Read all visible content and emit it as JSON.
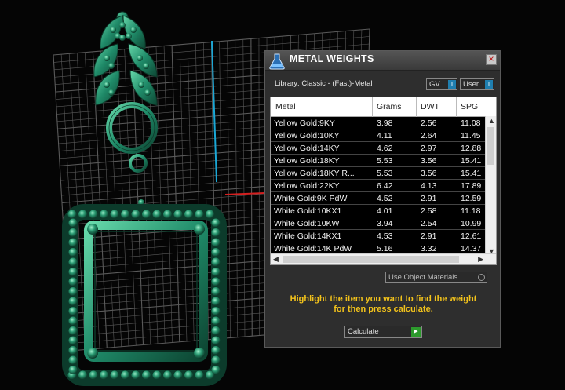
{
  "panel": {
    "title": "METAL WEIGHTS",
    "close_glyph": "×",
    "library": "Library: Classic - (Fast)-Metal",
    "gv_label": "GV",
    "user_label": "User",
    "toggle_glyph": "I"
  },
  "table": {
    "headers": [
      "Metal",
      "Grams",
      "DWT",
      "SPG"
    ],
    "rows": [
      [
        "Yellow Gold:9KY",
        "3.98",
        "2.56",
        "11.08"
      ],
      [
        "Yellow Gold:10KY",
        "4.11",
        "2.64",
        "11.45"
      ],
      [
        "Yellow Gold:14KY",
        "4.62",
        "2.97",
        "12.88"
      ],
      [
        "Yellow Gold:18KY",
        "5.53",
        "3.56",
        "15.41"
      ],
      [
        "Yellow Gold:18KY R...",
        "5.53",
        "3.56",
        "15.41"
      ],
      [
        "Yellow Gold:22KY",
        "6.42",
        "4.13",
        "17.89"
      ],
      [
        "White Gold:9K PdW",
        "4.52",
        "2.91",
        "12.59"
      ],
      [
        "White Gold:10KX1",
        "4.01",
        "2.58",
        "11.18"
      ],
      [
        "White Gold:10KW",
        "3.94",
        "2.54",
        "10.99"
      ],
      [
        "White Gold:14KX1",
        "4.53",
        "2.91",
        "12.61"
      ],
      [
        "White Gold:14K PdW",
        "5.16",
        "3.32",
        "14.37"
      ]
    ]
  },
  "use_object_materials": "Use Object Materials",
  "hint_line1": "Highlight the item you want to find the weight",
  "hint_line2": "for then press calculate.",
  "calculate_label": "Calculate",
  "colors": {
    "jewelry_green": "#1f8a68",
    "axis_blue": "#1aa7d6",
    "axis_red": "#d42020",
    "hint_yellow": "#f2c21b",
    "selection_black": "#000000"
  }
}
